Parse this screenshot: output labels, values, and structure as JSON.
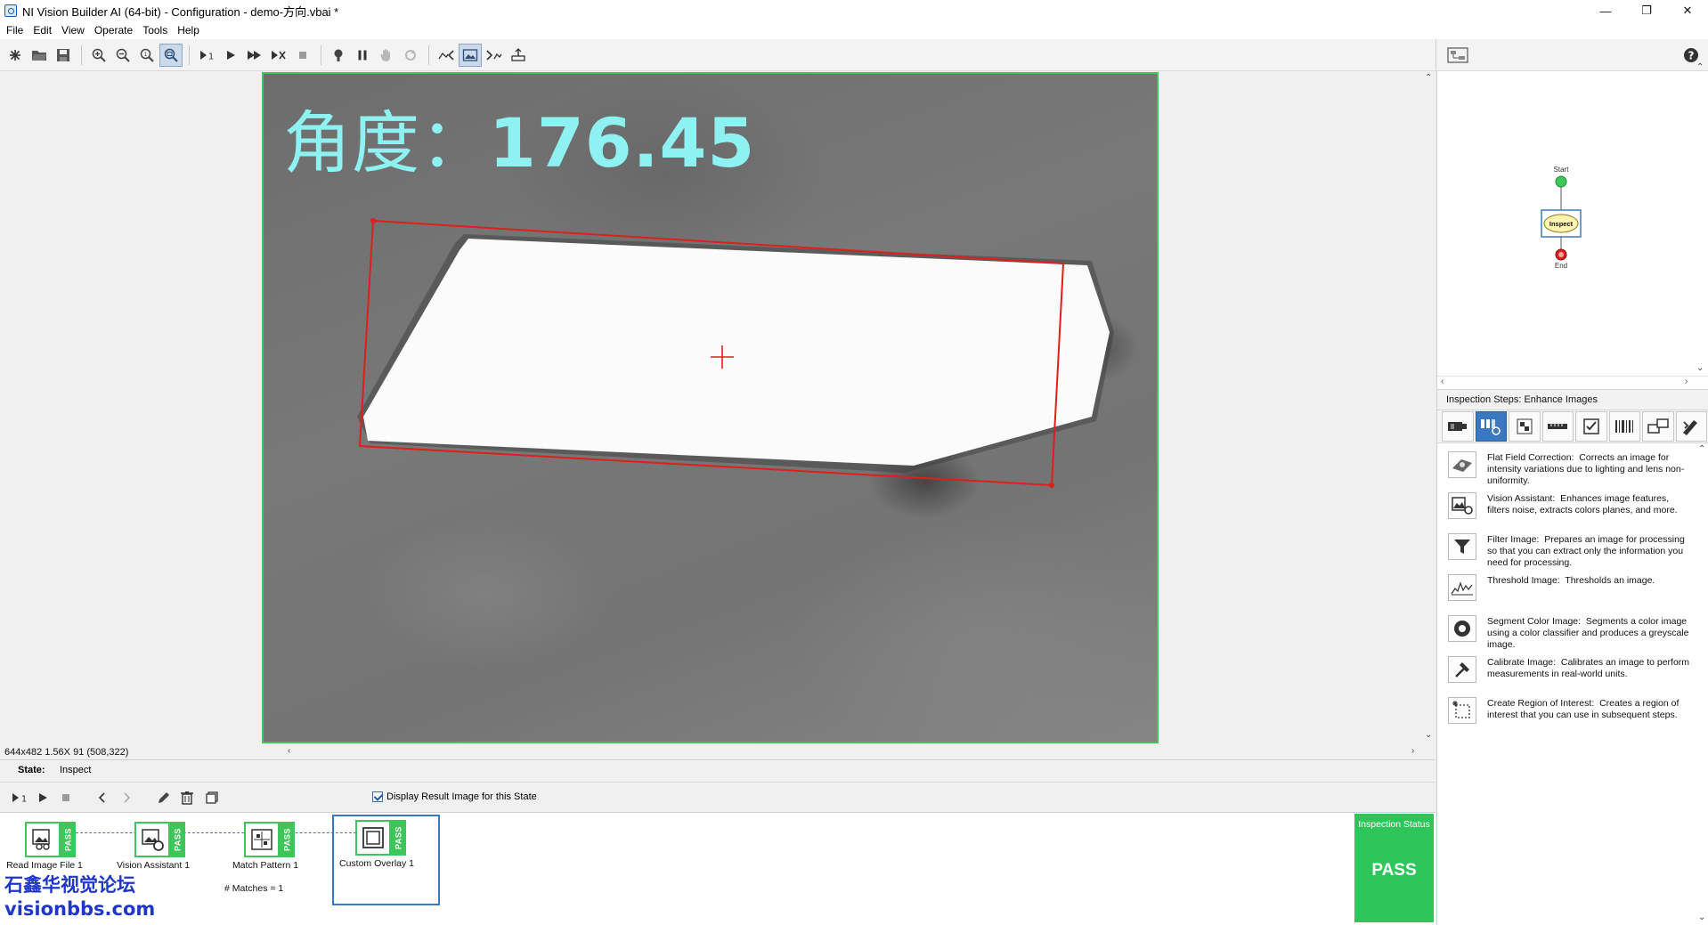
{
  "window": {
    "title": "NI Vision Builder AI (64-bit) - Configuration - demo-方向.vbai *",
    "minimize": "—",
    "maximize": "❐",
    "close": "✕"
  },
  "menu": [
    "File",
    "Edit",
    "View",
    "Operate",
    "Tools",
    "Help"
  ],
  "toolbar": {
    "icons": [
      "new-icon",
      "open-folder-icon",
      "save-icon",
      "zoom-in-icon",
      "zoom-out-icon",
      "zoom-1to1-icon",
      "zoom-fit-icon",
      "run-once-icon",
      "run-icon",
      "run-continuous-icon",
      "run-stop-icon",
      "stop-icon",
      "breakpoint-icon",
      "pause-icon",
      "hand-icon",
      "refresh-icon",
      "back-nav-icon",
      "image-view-icon",
      "forward-nav-icon",
      "export-icon"
    ],
    "help_label": "?"
  },
  "image": {
    "angle_prefix": "角度：",
    "angle_value": "176.45",
    "status_line": "644x482 1.56X 91    (508,322)",
    "colors": {
      "roi": "#e11d1d",
      "frame": "#3ec65a",
      "overlay_text": "#8ff2f2"
    }
  },
  "flowchart": {
    "start_label": "Start",
    "state_label": "Inspect",
    "end_label": "End"
  },
  "steps_panel": {
    "header": "Inspection Steps: Enhance Images",
    "category_icons": [
      "acquire-images-icon",
      "enhance-images-icon",
      "locate-features-icon",
      "measure-features-icon",
      "check-for-presence-icon",
      "identify-parts-icon",
      "communicate-icon",
      "use-additional-tools-icon"
    ],
    "steps": [
      {
        "icon": "flat-field-correction-icon",
        "name": "Flat Field Correction:",
        "desc": "Corrects an image for intensity variations due to lighting and lens non-uniformity."
      },
      {
        "icon": "vision-assistant-icon",
        "name": "Vision Assistant:",
        "desc": "Enhances image features, filters noise, extracts colors planes, and more."
      },
      {
        "icon": "filter-image-icon",
        "name": "Filter Image:",
        "desc": "Prepares an image for processing so that you can extract only the information you need for processing."
      },
      {
        "icon": "threshold-image-icon",
        "name": "Threshold Image:",
        "desc": "Thresholds an image."
      },
      {
        "icon": "segment-color-image-icon",
        "name": "Segment Color Image:",
        "desc": "Segments a color image using a color classifier and produces a greyscale image."
      },
      {
        "icon": "calibrate-image-icon",
        "name": "Calibrate Image:",
        "desc": "Calibrates an image to perform measurements in real-world units."
      },
      {
        "icon": "create-roi-icon",
        "name": "Create Region of Interest:",
        "desc": "Creates a region of interest that you can use in subsequent steps."
      }
    ]
  },
  "state_bar": {
    "label": "State:",
    "value": "Inspect"
  },
  "toolbar2": {
    "display_result_label": "Display Result Image for this State",
    "display_result_checked": true
  },
  "inspection_steps": [
    {
      "name": "Read Image File 1",
      "status": "PASS",
      "result": ""
    },
    {
      "name": "Vision Assistant 1",
      "status": "PASS",
      "result": ""
    },
    {
      "name": "Match Pattern 1",
      "status": "PASS",
      "result": "# Matches = 1"
    },
    {
      "name": "Custom Overlay 1",
      "status": "PASS",
      "result": ""
    }
  ],
  "inspection_status": {
    "label": "Inspection Status",
    "value": "PASS",
    "color": "#2ec55a"
  },
  "watermark": {
    "line1": "石鑫华视觉论坛",
    "line2": "visionbbs.com"
  }
}
